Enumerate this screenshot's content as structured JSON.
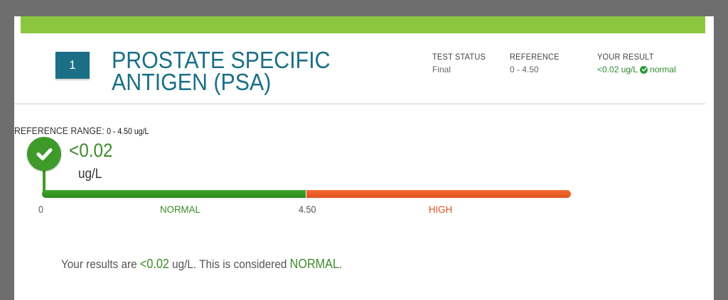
{
  "colors": {
    "accent_green": "#8cc63f",
    "title_teal": "#1a6f86",
    "normal_green": "#3e9b2a",
    "high_orange": "#e8582a"
  },
  "test": {
    "number": "1",
    "title": "PROSTATE SPECIFIC ANTIGEN (PSA)"
  },
  "meta": {
    "status_label": "TEST STATUS",
    "status_value": "Final",
    "reference_label": "REFERENCE",
    "reference_value": "0 - 4.50",
    "result_label": "YOUR RESULT",
    "result_value": "<0.02 ug/L",
    "result_status": "normal"
  },
  "range": {
    "label": "REFERENCE RANGE:",
    "value": "0 - 4.50 ug/L",
    "result_value": "<0.02",
    "result_unit": "ug/L",
    "ticks": [
      "0",
      "4.50"
    ],
    "zones": [
      "NORMAL",
      "HIGH"
    ],
    "result_position_fraction": 0.0
  },
  "summary": {
    "prefix": "Your results are",
    "value": "<0.02",
    "mid": "ug/L. This is considered",
    "verdict": "NORMAL",
    "suffix": "."
  }
}
